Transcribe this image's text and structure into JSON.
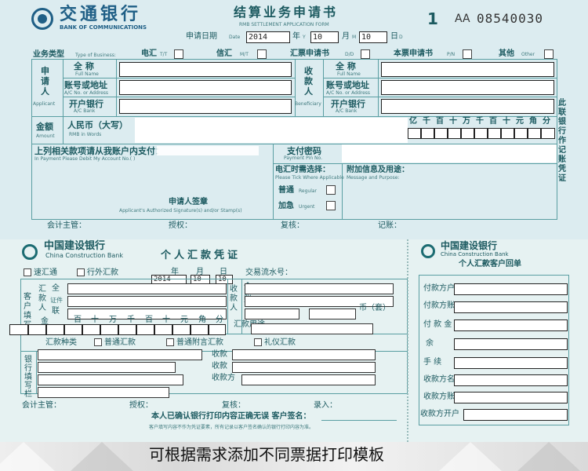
{
  "top_form": {
    "bank_name_cn": "交通银行",
    "bank_name_en": "BANK OF COMMUNICATIONS",
    "title_cn": "结算业务申请书",
    "title_en": "RMB SETTLEMENT APPLICATION FORM",
    "copy_no": "1",
    "serial_prefix": "AA",
    "serial_no": "08540030",
    "date_label": "申请日期",
    "date_label_en": "Date",
    "year_value": "2014",
    "year_label": "年",
    "year_en": "Y",
    "month_value": "10",
    "month_label": "月",
    "month_en": "M",
    "day_value": "10",
    "day_label": "日",
    "day_en": "D",
    "business_type_label": "业务类型",
    "business_type_en": "Type of Business:",
    "types": [
      {
        "cn": "电汇",
        "en": "T/T"
      },
      {
        "cn": "信汇",
        "en": "M/T"
      },
      {
        "cn": "汇票申请书",
        "en": "D/D"
      },
      {
        "cn": "本票申请书",
        "en": "P/N"
      },
      {
        "cn": "其他",
        "en": "Other"
      }
    ],
    "applicant_cn": "申请人",
    "applicant_en": "Applicant",
    "beneficiary_cn": "收款人",
    "beneficiary_en": "Beneficiary",
    "full_name_cn": "全  称",
    "full_name_en": "Full Name",
    "account_cn": "账号或地址",
    "account_en": "A/C No. or Address",
    "bank_cn": "开户银行",
    "bank_en": "A/C Bank",
    "amount_cn": "金额",
    "amount_en": "Amount",
    "currency_cn": "人民币（大写）",
    "currency_en": "RMB in Words",
    "digit_headers": [
      "亿",
      "千",
      "百",
      "十",
      "万",
      "千",
      "百",
      "十",
      "元",
      "角",
      "分"
    ],
    "debit_text_cn": "上列相关款项请从我账户内支付：",
    "debit_text_en": "In Payment Please Debit My Account No.(   )",
    "payment_pw_cn": "支付密码",
    "payment_pw_en": "Payment Pin No.",
    "remit_select_cn": "电汇时需选择：",
    "remit_select_en": "Please Tick Where Applicable",
    "regular_cn": "普通",
    "regular_en": "Regular",
    "urgent_cn": "加急",
    "urgent_en": "Urgent",
    "extra_cn": "附加信息及用途：",
    "extra_en": "Message and Purpose:",
    "signature_cn": "申请人签章",
    "signature_en": "Applicant's Authorized Signature(s) and/or Stamp(s)",
    "side_note": "此联银行作记账凭证",
    "footer": [
      "会计主管：",
      "授权：",
      "复核：",
      "记账："
    ]
  },
  "bottom_form": {
    "bank_name_cn": "中国建设银行",
    "bank_name_en": "China Construction Bank",
    "title": "个人汇款凭证",
    "fast_remit": "速汇通",
    "inter_bank": "行外汇款",
    "year_value": "2014",
    "year_label": "年",
    "month_value": "10",
    "month_label": "月",
    "day_value": "10",
    "day_label": "日",
    "txn_no": "交易流水号：",
    "customer_fill": "客户填写",
    "remitter": "汇款人",
    "payee": "收款人",
    "remitter_rows": [
      "全",
      "证件",
      "联"
    ],
    "payee_rows": [
      "全",
      "账"
    ],
    "currency_unit": "币（套）",
    "amount_label": "金",
    "digit_headers": [
      "百",
      "十",
      "万",
      "千",
      "百",
      "十",
      "元",
      "角",
      "分"
    ],
    "purpose": "汇款用途",
    "remit_type_label": "汇款种类",
    "remit_types": [
      "普通汇款",
      "普通附言汇款",
      "礼仪汇款"
    ],
    "bank_fill": "银行填写栏",
    "receive_rows": [
      "收款",
      "收款",
      "收款方"
    ],
    "footer": [
      "会计主管：",
      "授权：",
      "复核：",
      "录入："
    ],
    "confirm_text": "本人已确认银行打印内容正确无误  客户签名：",
    "note_text": "客户填写内容不作为凭证要素，所有记录以客户签名确认的银行打印内容为准。"
  },
  "receipt": {
    "bank_name_cn": "中国建设银行",
    "bank_name_en": "China Construction Bank",
    "title": "个人汇款客户回单",
    "rows": [
      "付款方户",
      "付款方账",
      "付 款 金",
      "余",
      "手  续",
      "收款方名",
      "收款方账",
      "收款方开户"
    ]
  },
  "banner": {
    "text": "可根据需求添加不同票据打印模板"
  }
}
